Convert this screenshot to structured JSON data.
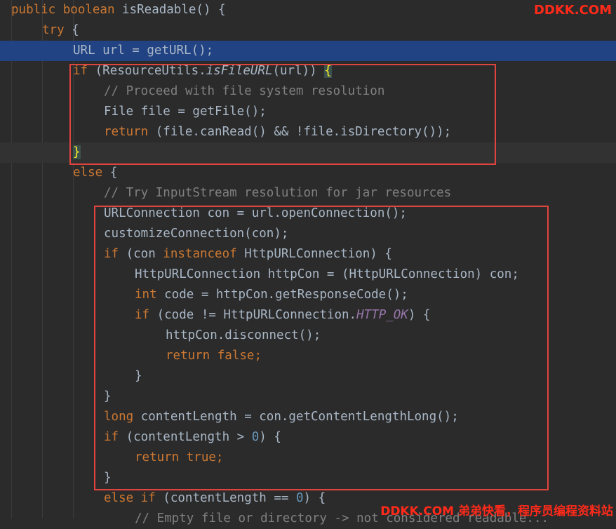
{
  "watermark": {
    "top": "DDKK.COM",
    "bottom": "DDKK.COM 弟弟快看，程序员编程资料站"
  },
  "code": {
    "l1_kw": "public boolean ",
    "l1_rest": "isReadable() {",
    "l2_kw": "try",
    "l2_rest": " {",
    "l3": "URL url = getURL();",
    "l4_kw": "if",
    "l4_a": " (ResourceUtils.",
    "l4_method": "isFileURL",
    "l4_b": "(url)) ",
    "l4_brace": "{",
    "l5": "// Proceed with file system resolution",
    "l6": "File file = getFile();",
    "l7_kw": "return",
    "l7_rest": " (file.canRead() && !file.isDirectory());",
    "l8_brace": "}",
    "l9_kw": "else",
    "l9_rest": " {",
    "l10": "// Try InputStream resolution for jar resources",
    "l11": "URLConnection con = url.openConnection();",
    "l12": "customizeConnection(con);",
    "l13_kw": "if",
    "l13_a": " (con ",
    "l13_kw2": "instanceof",
    "l13_b": " HttpURLConnection) {",
    "l14": "HttpURLConnection httpCon = (HttpURLConnection) con;",
    "l15_kw": "int",
    "l15_rest": " code = httpCon.getResponseCode();",
    "l16_kw": "if",
    "l16_a": " (code != HttpURLConnection.",
    "l16_const": "HTTP_OK",
    "l16_b": ") {",
    "l17": "httpCon.disconnect();",
    "l18_kw": "return false",
    "l18_rest": ";",
    "l19": "}",
    "l20": "}",
    "l21_kw": "long",
    "l21_rest": " contentLength = con.getContentLengthLong();",
    "l22_kw": "if",
    "l22_a": " (contentLength > ",
    "l22_num": "0",
    "l22_b": ") {",
    "l23_kw": "return true",
    "l23_rest": ";",
    "l24": "}",
    "l25_kw": "else if",
    "l25_a": " (contentLength == ",
    "l25_num": "0",
    "l25_b": ") {",
    "l26": "// Empty file or directory -> not considered readable..."
  },
  "colors": {
    "background": "#2b2b2b",
    "selection": "#214283",
    "keyword": "#cc7832",
    "comment": "#808080",
    "number": "#6897bb",
    "constant": "#9876aa",
    "highlight_box": "#e0443e",
    "watermark": "#ff2a1a"
  }
}
